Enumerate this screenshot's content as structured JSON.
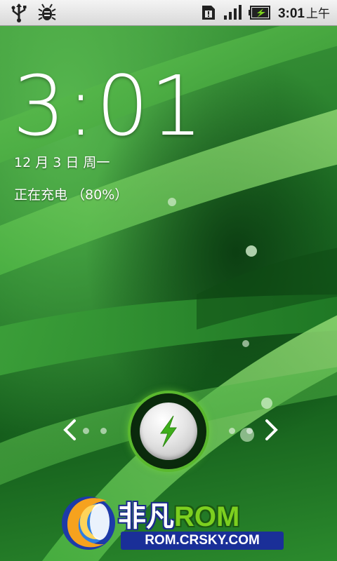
{
  "status_bar": {
    "left_icons": [
      "usb-icon",
      "debug-icon"
    ],
    "right_icons": [
      "sim-alert-icon",
      "signal-icon",
      "battery-charging-icon"
    ],
    "time": "3:01",
    "ampm": "上午"
  },
  "lock_screen": {
    "clock": "3:01",
    "date": "12 月 3 日 周一",
    "charging_status": "正在充电 （80%）",
    "battery_percent": 80
  },
  "unlock": {
    "left_arrow_icon": "chevron-left-icon",
    "right_arrow_icon": "chevron-right-icon",
    "handle_icon": "lightning-bolt-icon"
  },
  "watermark": {
    "brand_cn": "非凡",
    "brand_en": "ROM",
    "url": "ROM.CRSKY.COM"
  },
  "colors": {
    "status_bar_bg": "#e6e6e6",
    "accent_green": "#5ab82e",
    "clock_text": "#ffffff"
  }
}
